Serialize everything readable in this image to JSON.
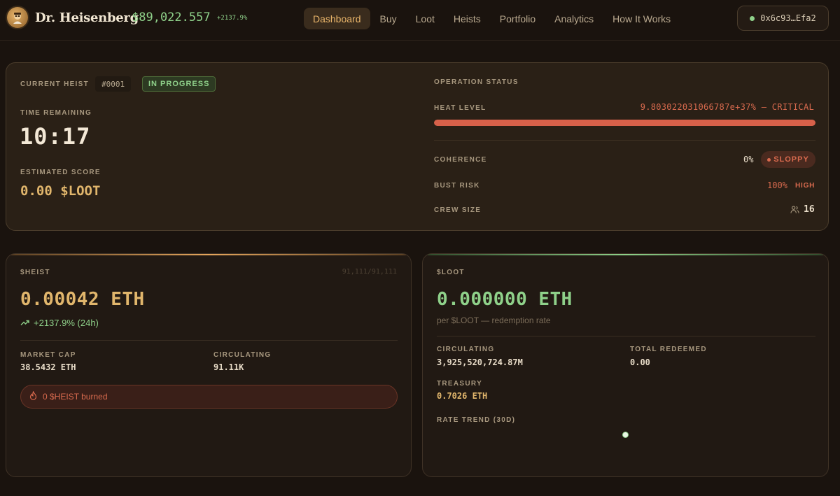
{
  "header": {
    "brand": "Dr. Heisenberg",
    "price": "$89,022.557",
    "price_change": "+2137.9%",
    "nav": [
      "Dashboard",
      "Buy",
      "Loot",
      "Heists",
      "Portfolio",
      "Analytics",
      "How It Works"
    ],
    "active_nav": "Dashboard",
    "wallet": "0x6c93…Efa2"
  },
  "heist": {
    "current_label": "CURRENT HEIST",
    "id": "#0001",
    "status": "IN PROGRESS",
    "time_label": "TIME REMAINING",
    "time": "10:17",
    "score_label": "ESTIMATED SCORE",
    "score": "0.00 $LOOT",
    "op_status_label": "OPERATION STATUS",
    "heat_label": "HEAT LEVEL",
    "heat_value": "9.803022031066787e+37% — CRITICAL",
    "heat_fill_fraction": 1.0,
    "coherence_label": "COHERENCE",
    "coherence": "0%",
    "coherence_badge": "SLOPPY",
    "bust_label": "BUST RISK",
    "bust": "100%",
    "bust_level": "HIGH",
    "crew_label": "CREW SIZE",
    "crew": "16"
  },
  "heist_token": {
    "title": "$HEIST",
    "supply": "91,111/91,111",
    "price": "0.00042 ETH",
    "change": "+2137.9% (24h)",
    "market_cap_label": "MARKET CAP",
    "market_cap": "38.5432 ETH",
    "circulating_label": "CIRCULATING",
    "circulating": "91.11K",
    "burned": "0 $HEIST burned"
  },
  "loot_token": {
    "title": "$LOOT",
    "price": "0.000000 ETH",
    "subtitle": "per $LOOT — redemption rate",
    "circulating_label": "CIRCULATING",
    "circulating": "3,925,520,724.87M",
    "redeemed_label": "TOTAL REDEEMED",
    "redeemed": "0.00",
    "treasury_label": "TREASURY",
    "treasury": "0.7026 ETH",
    "trend_label": "RATE TREND (30D)"
  },
  "colors": {
    "accent_gold": "#e1b66c",
    "accent_green": "#8fd18a",
    "danger": "#d86a4e",
    "background": "#1a130e"
  },
  "icons": {
    "logo": "scientist-logo-icon",
    "wallet": "status-dot-icon",
    "trend": "trending-up-icon",
    "burn": "flame-icon",
    "crew": "users-icon"
  }
}
